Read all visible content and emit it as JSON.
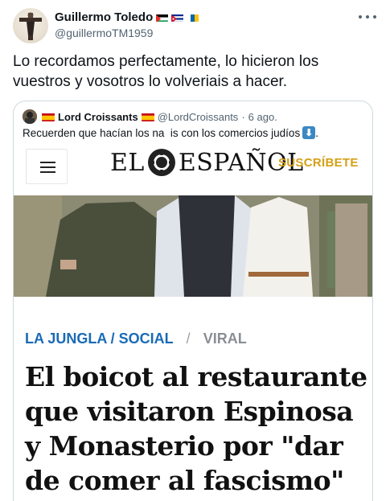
{
  "author": {
    "name": "Guillermo Toledo",
    "handle": "@guillermoTM1959",
    "flags": [
      "palestine-flag",
      "cuba-flag",
      "canarias-flag"
    ]
  },
  "tweet": {
    "text": "Lo recordamos perfectamente, lo hicieron los vuestros y vosotros lo volveriais a hacer."
  },
  "quoted": {
    "name": "Lord Croissants",
    "handle": "@LordCroissants",
    "separator": "·",
    "date": "6 ago.",
    "text": "Recuerden que hacían los na  is con los comercios judíos",
    "emoji": "⬇"
  },
  "article": {
    "logo_left": "EL",
    "logo_right": "ESPAÑOL",
    "subscribe": "SUSCRÍBETE",
    "section": "LA JUNGLA / SOCIAL",
    "separator": "/",
    "tag": "VIRAL",
    "headline": "El boicot al restaurante que visitaron Espinosa y Monasterio por \"dar de comer al fascismo\""
  },
  "colors": {
    "section_blue": "#1a6bb5",
    "subscribe_gold": "#d4a017",
    "handle_gray": "#536471",
    "border": "#cfd9de"
  },
  "icons": {
    "more": "more-horizontal-icon",
    "menu": "hamburger-menu-icon",
    "logo": "lion-logo-icon"
  }
}
